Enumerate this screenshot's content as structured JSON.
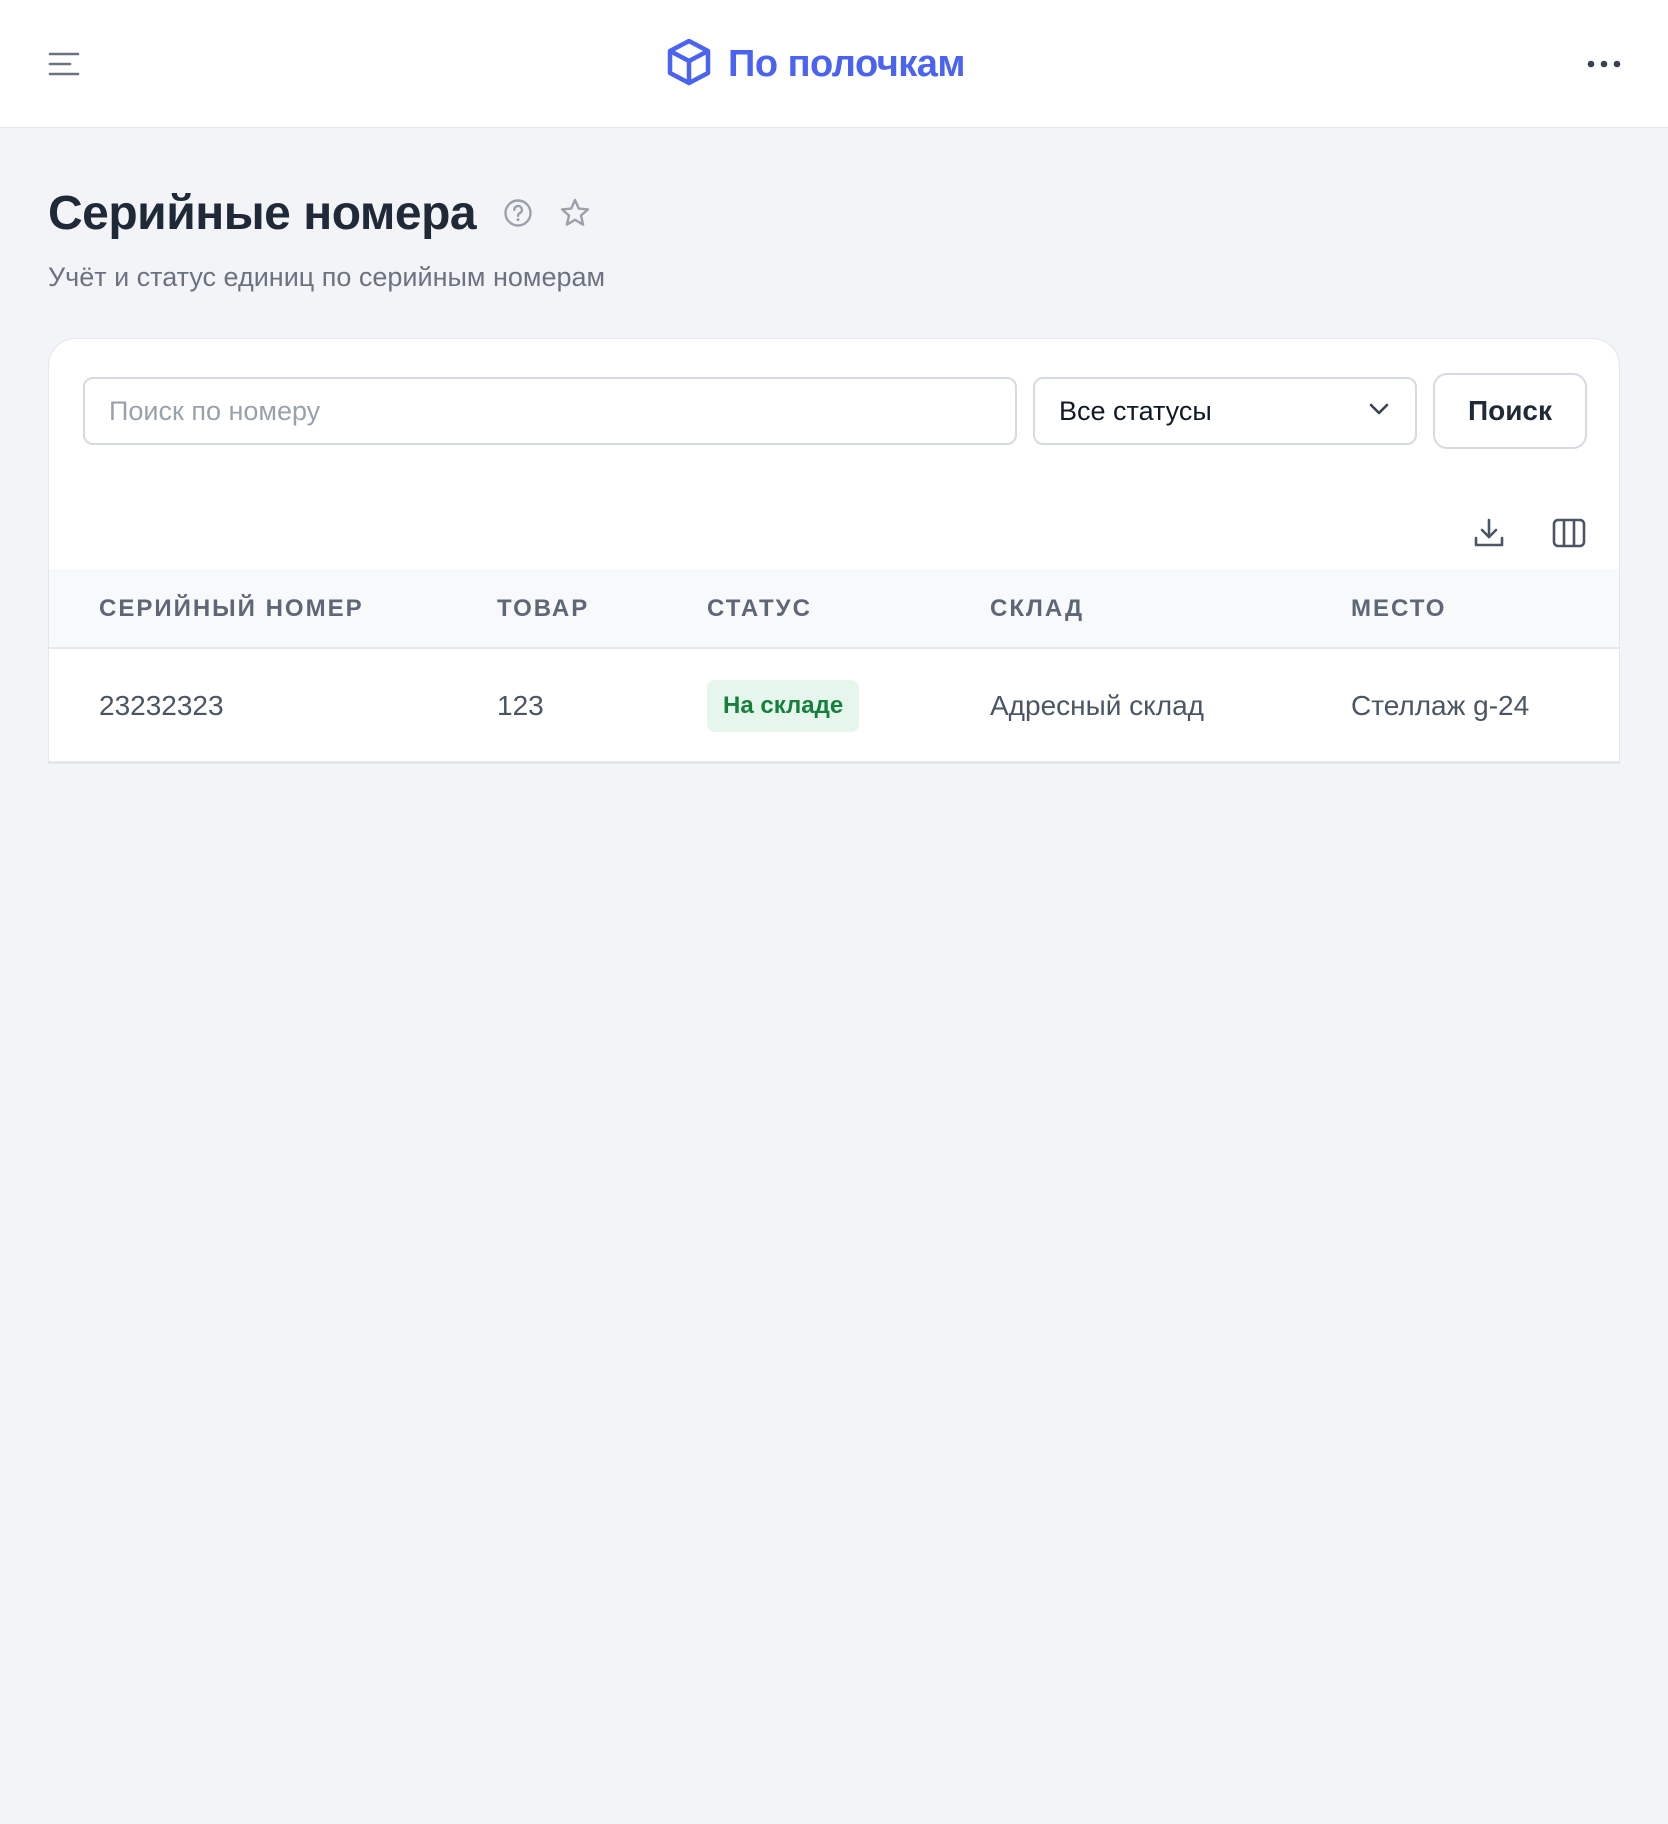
{
  "app": {
    "name": "По полочкам",
    "brand_color": "#4a63f0",
    "menu_icon": "hamburger-menu-icon",
    "logo_icon": "cube-icon",
    "more_icon": "more-horizontal-icon"
  },
  "page": {
    "title": "Серийные номера",
    "subtitle": "Учёт и статус единиц по серийным номерам",
    "help_icon": "help-circle-icon",
    "favorite_icon": "star-outline-icon"
  },
  "filters": {
    "search_placeholder": "Поиск по номеру",
    "search_value": "",
    "status_selected": "Все статусы",
    "search_button": "Поиск"
  },
  "toolbar": {
    "export_icon": "download-icon",
    "columns_icon": "columns-icon"
  },
  "table": {
    "columns": [
      "СЕРИЙНЫЙ НОМЕР",
      "ТОВАР",
      "СТАТУС",
      "СКЛАД",
      "МЕСТО"
    ],
    "rows": [
      {
        "serial": "23232323",
        "product": "123",
        "status": "На складе",
        "warehouse": "Адресный склад",
        "location": "Стеллаж g-24"
      }
    ],
    "status_colors": {
      "in_stock_bg": "#e6f6ec",
      "in_stock_text": "#15803d"
    }
  }
}
